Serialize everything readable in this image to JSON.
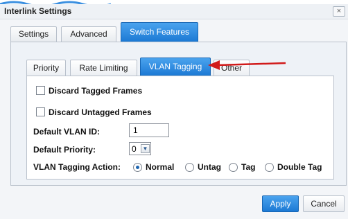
{
  "dialog": {
    "title": "Interlink Settings",
    "close_label": "×"
  },
  "outer_tabs": [
    {
      "label": "Settings",
      "active": false
    },
    {
      "label": "Advanced",
      "active": false
    },
    {
      "label": "Switch Features",
      "active": true
    }
  ],
  "inner_tabs": [
    {
      "label": "Priority",
      "active": false
    },
    {
      "label": "Rate Limiting",
      "active": false
    },
    {
      "label": "VLAN Tagging",
      "active": true
    },
    {
      "label": "Other",
      "active": false
    }
  ],
  "form": {
    "discard_tagged_label": "Discard Tagged Frames",
    "discard_tagged_checked": false,
    "discard_untagged_label": "Discard Untagged Frames",
    "discard_untagged_checked": false,
    "default_vlan_label": "Default VLAN ID:",
    "default_vlan_value": "1",
    "default_priority_label": "Default Priority:",
    "default_priority_value": "0",
    "tagging_action_label": "VLAN Tagging Action:",
    "tagging_options": [
      "Normal",
      "Untag",
      "Tag",
      "Double Tag"
    ],
    "tagging_selected": "Normal"
  },
  "buttons": {
    "apply_label": "Apply",
    "cancel_label": "Cancel"
  },
  "colors": {
    "accent_blue": "#1c79d4",
    "annotation_red": "#d11a1a"
  },
  "icons": {
    "close": "close-icon",
    "dropdown": "chevron-down-icon",
    "annotation": "red-arrow-annotation"
  }
}
